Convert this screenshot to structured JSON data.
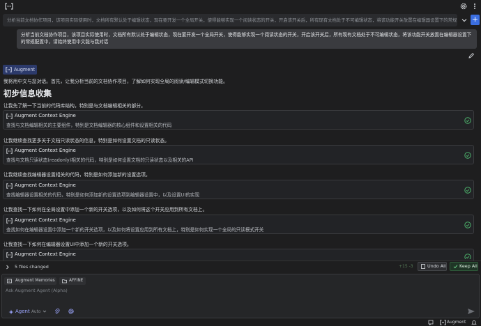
{
  "thread": {
    "title": "分析当前文档协作项目，该项目实际使用时，文档所有默认处于编辑状态，现在要开发一个全局开关，使得能够实现一个阅读状态的开关，开启该开关后，所有现有文档处于不可编辑状态，将该功能开关放置在编辑器设置下的常规..."
  },
  "user_message": {
    "text": "分析当前文档协作项目，该项目实际使用时，文档所有默认处于编辑状态，现在要开发一个全局开关，使得能够实现一个阅读状态的开关，开启该开关后，所有现有文档处于不可编辑状态，将该功能开关放置在编辑器设置下的常规配置中，请始终使用中文能与我对话"
  },
  "assistant": {
    "badge": "Augment",
    "intro": "我将用中文与您对话。首先，让我分析当前的文档协作项目，了解如何实现全局的阅读/编辑模式切换功能。",
    "heading": "初步信息收集",
    "steps": [
      {
        "lead": "让我先了解一下当前的代码库结构，特别是与文档编辑相关的部分。",
        "tool": "Augment Context Engine",
        "desc": "查找与文档编辑相关的主要组件，特别是文档编辑器的核心组件和设置相关的代码"
      },
      {
        "lead": "让我继续查找更多关于文档只读状态的信息，特别是如何设置文档的只读状态。",
        "tool": "Augment Context Engine",
        "desc": "查找与文档只读状态(readonly)相关的代码，特别是如何设置文档的只读状态以及相关的API"
      },
      {
        "lead": "让我继续查找编辑器设置相关的代码，特别是如何添加新的设置选项。",
        "tool": "Augment Context Engine",
        "desc": "查找编辑器设置相关的代码，特别是如何添加新的设置选项到编辑器设置中，以及设置UI的实现"
      },
      {
        "lead": "让我查找一下如何在全局设置中添加一个新的开关选项，以及如何将这个开关应用到所有文档上。",
        "tool": "Augment Context Engine",
        "desc": "查找如何在编辑器设置中添加一个新的开关选项，以及如何将设置应用到所有文档上，特别是如何实现一个全局的只读模式开关"
      },
      {
        "lead": "让我查找一下如何在编辑器设置UI中添加一个新的开关选项。",
        "tool": "Augment Context Engine",
        "desc": ""
      }
    ]
  },
  "changes": {
    "files_changed": "5 files changed",
    "diffstat": "+15 -3",
    "undo_all": "Undo All",
    "keep_all": "Keep All"
  },
  "input": {
    "chips": [
      "Augment Memories",
      "AFFINE"
    ],
    "placeholder": "Ask Augment Agent (Alpha)",
    "mode": "Agent",
    "mode_sub": "Auto"
  },
  "statusbar": {
    "label": "Augment"
  },
  "colors": {
    "accent": "#3b6ee0",
    "check": "#4caf6a",
    "keep_bg": "#1f3526"
  }
}
